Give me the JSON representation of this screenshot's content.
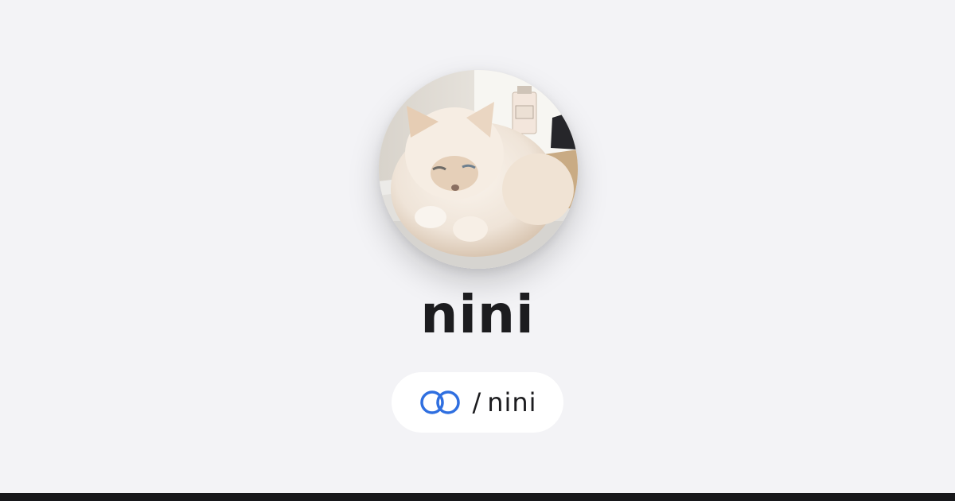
{
  "profile": {
    "display_name": "nini",
    "handle": "nini",
    "separator": "/",
    "avatar_description": "cat-photo"
  },
  "colors": {
    "background": "#f3f3f6",
    "text": "#1c1c1f",
    "brand_blue": "#2f6fe0",
    "pill_background": "#ffffff",
    "bottom_bar": "#17171a"
  },
  "icons": {
    "brand_logo": "linked-rings-icon"
  }
}
